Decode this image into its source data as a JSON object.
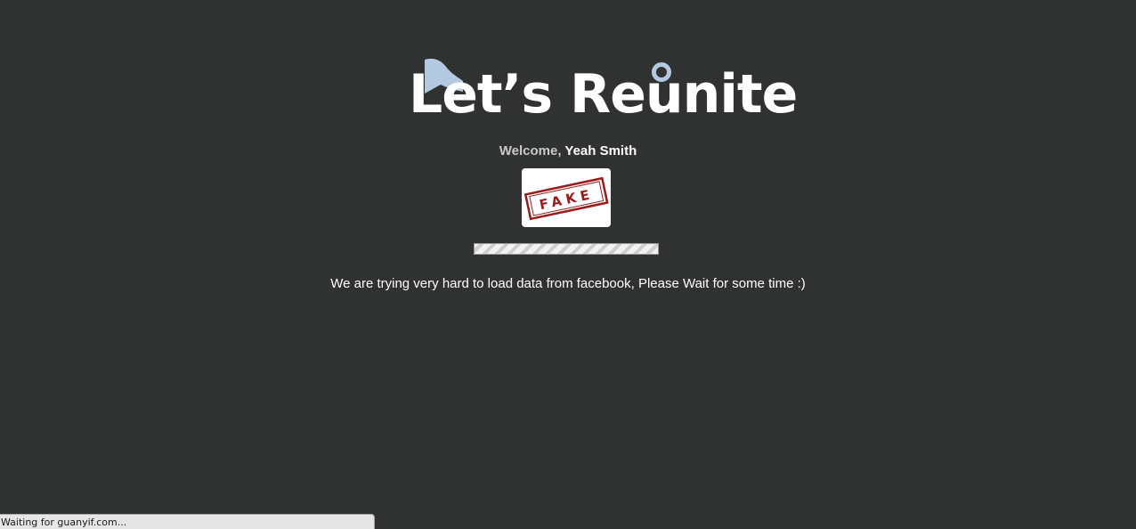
{
  "logo": {
    "text": "Let’s Reunite",
    "accent_color": "#b3c9e2"
  },
  "welcome": {
    "greeting": "Welcome,",
    "user_name": "Yeah Smith"
  },
  "avatar": {
    "stamp_text": "FAKE",
    "stamp_color": "#9b1b1b"
  },
  "progress": {
    "indeterminate": true
  },
  "message": "We are trying very hard to load data from facebook, Please Wait for some time :)",
  "status_bar": {
    "text": "Waiting for guanyif.com..."
  },
  "colors": {
    "background": "#303131",
    "text": "#ffffff",
    "welcome_muted": "#c9cacb"
  }
}
